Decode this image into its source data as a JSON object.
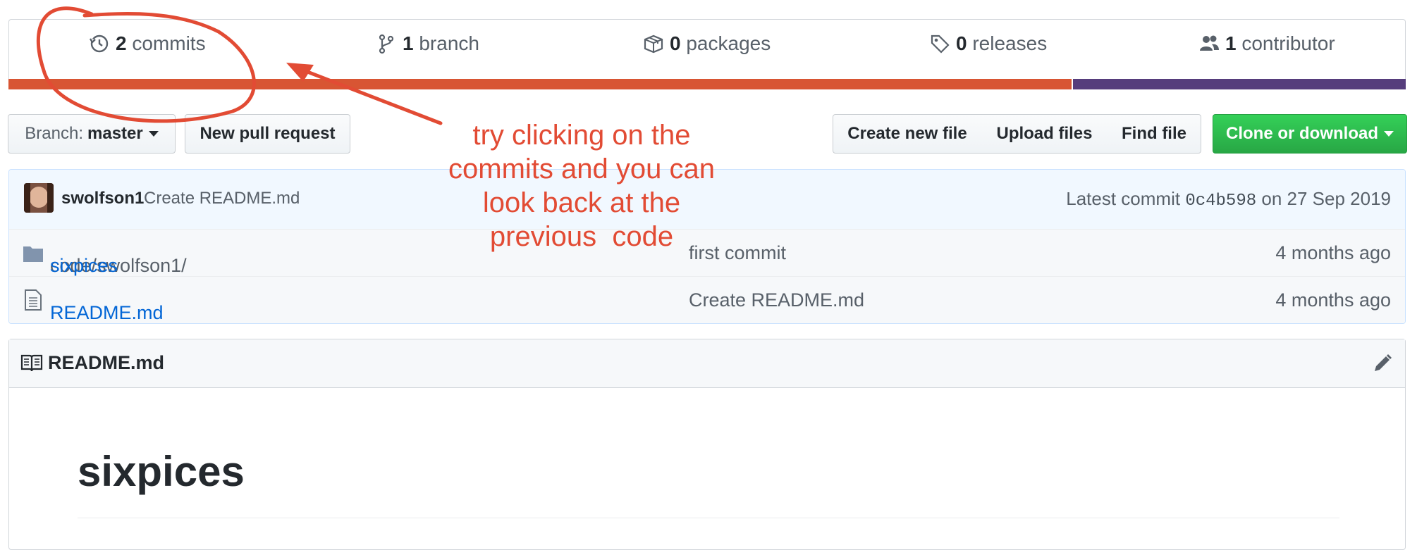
{
  "stats": {
    "commits": {
      "count": "2",
      "label": "commits",
      "icon": "history-icon"
    },
    "branch": {
      "count": "1",
      "label": "branch",
      "icon": "git-branch-icon"
    },
    "packages": {
      "count": "0",
      "label": "packages",
      "icon": "package-icon"
    },
    "releases": {
      "count": "0",
      "label": "releases",
      "icon": "tag-icon"
    },
    "contributors": {
      "count": "1",
      "label": "contributor",
      "icon": "people-icon"
    }
  },
  "language_bar": {
    "segments": [
      {
        "share": 0.762,
        "color": "#d85533"
      },
      {
        "share": 0.238,
        "color": "#563d7c"
      }
    ]
  },
  "toolbar": {
    "branch_prefix": "Branch:",
    "branch_name": "master",
    "new_pull_request": "New pull request",
    "create_new_file": "Create new file",
    "upload_files": "Upload files",
    "find_file": "Find file",
    "clone_or_download": "Clone or download"
  },
  "latest_commit": {
    "author": "swolfson1",
    "message": "Create README.md",
    "prefix": "Latest commit",
    "sha": "0c4b598",
    "date_prefix": "on",
    "date": "27 Sep 2019"
  },
  "files": [
    {
      "icon": "folder-icon",
      "path_prefix": "code/swolfson1/",
      "name": "sixpices",
      "message": "first commit",
      "age": "4 months ago"
    },
    {
      "icon": "file-icon",
      "path_prefix": "",
      "name": "README.md",
      "message": "Create README.md",
      "age": "4 months ago"
    }
  ],
  "readme": {
    "filename": "README.md",
    "heading": "sixpices"
  },
  "annotation": {
    "lines": [
      "try clicking on the",
      "commits and you can",
      "look back at the",
      "previous  code"
    ],
    "color": "#e24b34"
  },
  "colors": {
    "link": "#0366d6",
    "green_button": "#28a745",
    "annotation_red": "#e24b34"
  }
}
